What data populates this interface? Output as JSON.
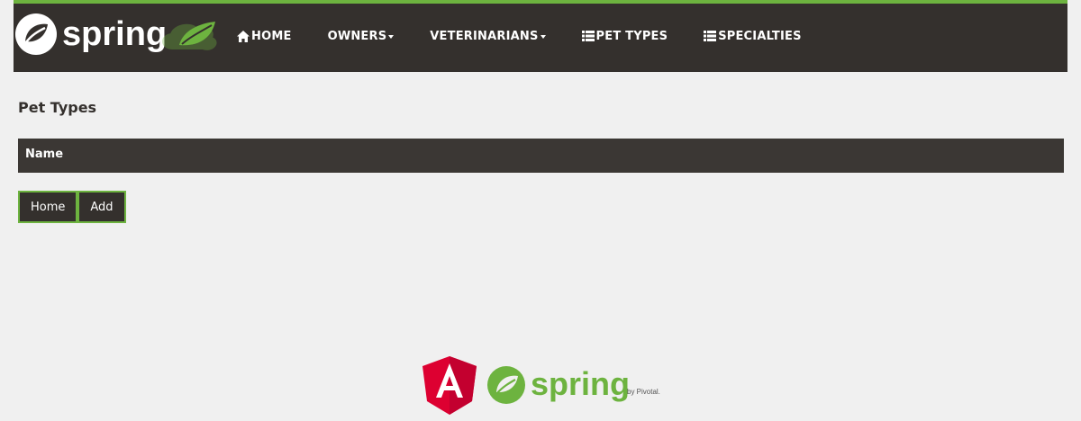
{
  "brand": {
    "logo_text": "spring"
  },
  "nav": {
    "home": "HOME",
    "owners": "OWNERS",
    "veterinarians": "VETERINARIANS",
    "pet_types": "PET TYPES",
    "specialties": "SPECIALTIES"
  },
  "page": {
    "title": "Pet Types"
  },
  "table": {
    "columns": [
      "Name"
    ]
  },
  "buttons": {
    "home": "Home",
    "add": "Add"
  },
  "footer": {
    "spring_text": "spring",
    "pivotal_text": "by Pivotal."
  },
  "colors": {
    "navbar": "#34302d",
    "accent": "#6db33f",
    "background": "#f0f0f0",
    "angular_red": "#c3002f"
  }
}
